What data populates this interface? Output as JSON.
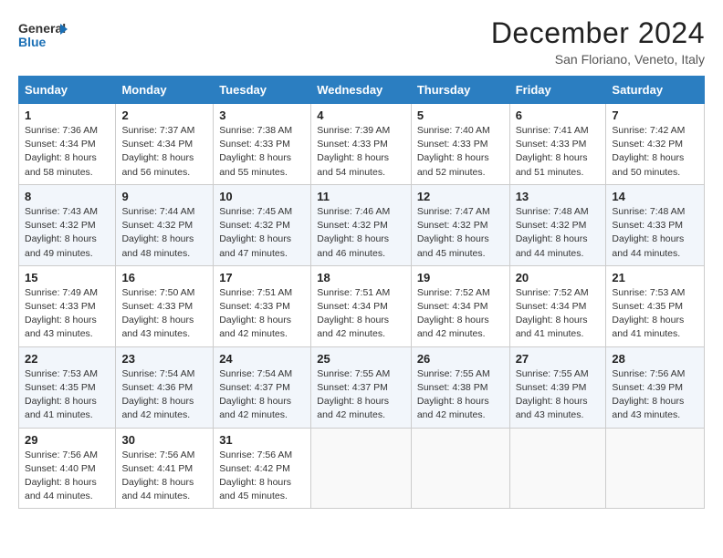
{
  "logo": {
    "line1": "General",
    "line2": "Blue",
    "icon": "▶"
  },
  "title": "December 2024",
  "location": "San Floriano, Veneto, Italy",
  "days_of_week": [
    "Sunday",
    "Monday",
    "Tuesday",
    "Wednesday",
    "Thursday",
    "Friday",
    "Saturday"
  ],
  "weeks": [
    [
      {
        "day": 1,
        "sunrise": "7:36 AM",
        "sunset": "4:34 PM",
        "daylight": "8 hours and 58 minutes."
      },
      {
        "day": 2,
        "sunrise": "7:37 AM",
        "sunset": "4:34 PM",
        "daylight": "8 hours and 56 minutes."
      },
      {
        "day": 3,
        "sunrise": "7:38 AM",
        "sunset": "4:33 PM",
        "daylight": "8 hours and 55 minutes."
      },
      {
        "day": 4,
        "sunrise": "7:39 AM",
        "sunset": "4:33 PM",
        "daylight": "8 hours and 54 minutes."
      },
      {
        "day": 5,
        "sunrise": "7:40 AM",
        "sunset": "4:33 PM",
        "daylight": "8 hours and 52 minutes."
      },
      {
        "day": 6,
        "sunrise": "7:41 AM",
        "sunset": "4:33 PM",
        "daylight": "8 hours and 51 minutes."
      },
      {
        "day": 7,
        "sunrise": "7:42 AM",
        "sunset": "4:32 PM",
        "daylight": "8 hours and 50 minutes."
      }
    ],
    [
      {
        "day": 8,
        "sunrise": "7:43 AM",
        "sunset": "4:32 PM",
        "daylight": "8 hours and 49 minutes."
      },
      {
        "day": 9,
        "sunrise": "7:44 AM",
        "sunset": "4:32 PM",
        "daylight": "8 hours and 48 minutes."
      },
      {
        "day": 10,
        "sunrise": "7:45 AM",
        "sunset": "4:32 PM",
        "daylight": "8 hours and 47 minutes."
      },
      {
        "day": 11,
        "sunrise": "7:46 AM",
        "sunset": "4:32 PM",
        "daylight": "8 hours and 46 minutes."
      },
      {
        "day": 12,
        "sunrise": "7:47 AM",
        "sunset": "4:32 PM",
        "daylight": "8 hours and 45 minutes."
      },
      {
        "day": 13,
        "sunrise": "7:48 AM",
        "sunset": "4:32 PM",
        "daylight": "8 hours and 44 minutes."
      },
      {
        "day": 14,
        "sunrise": "7:48 AM",
        "sunset": "4:33 PM",
        "daylight": "8 hours and 44 minutes."
      }
    ],
    [
      {
        "day": 15,
        "sunrise": "7:49 AM",
        "sunset": "4:33 PM",
        "daylight": "8 hours and 43 minutes."
      },
      {
        "day": 16,
        "sunrise": "7:50 AM",
        "sunset": "4:33 PM",
        "daylight": "8 hours and 43 minutes."
      },
      {
        "day": 17,
        "sunrise": "7:51 AM",
        "sunset": "4:33 PM",
        "daylight": "8 hours and 42 minutes."
      },
      {
        "day": 18,
        "sunrise": "7:51 AM",
        "sunset": "4:34 PM",
        "daylight": "8 hours and 42 minutes."
      },
      {
        "day": 19,
        "sunrise": "7:52 AM",
        "sunset": "4:34 PM",
        "daylight": "8 hours and 42 minutes."
      },
      {
        "day": 20,
        "sunrise": "7:52 AM",
        "sunset": "4:34 PM",
        "daylight": "8 hours and 41 minutes."
      },
      {
        "day": 21,
        "sunrise": "7:53 AM",
        "sunset": "4:35 PM",
        "daylight": "8 hours and 41 minutes."
      }
    ],
    [
      {
        "day": 22,
        "sunrise": "7:53 AM",
        "sunset": "4:35 PM",
        "daylight": "8 hours and 41 minutes."
      },
      {
        "day": 23,
        "sunrise": "7:54 AM",
        "sunset": "4:36 PM",
        "daylight": "8 hours and 42 minutes."
      },
      {
        "day": 24,
        "sunrise": "7:54 AM",
        "sunset": "4:37 PM",
        "daylight": "8 hours and 42 minutes."
      },
      {
        "day": 25,
        "sunrise": "7:55 AM",
        "sunset": "4:37 PM",
        "daylight": "8 hours and 42 minutes."
      },
      {
        "day": 26,
        "sunrise": "7:55 AM",
        "sunset": "4:38 PM",
        "daylight": "8 hours and 42 minutes."
      },
      {
        "day": 27,
        "sunrise": "7:55 AM",
        "sunset": "4:39 PM",
        "daylight": "8 hours and 43 minutes."
      },
      {
        "day": 28,
        "sunrise": "7:56 AM",
        "sunset": "4:39 PM",
        "daylight": "8 hours and 43 minutes."
      }
    ],
    [
      {
        "day": 29,
        "sunrise": "7:56 AM",
        "sunset": "4:40 PM",
        "daylight": "8 hours and 44 minutes."
      },
      {
        "day": 30,
        "sunrise": "7:56 AM",
        "sunset": "4:41 PM",
        "daylight": "8 hours and 44 minutes."
      },
      {
        "day": 31,
        "sunrise": "7:56 AM",
        "sunset": "4:42 PM",
        "daylight": "8 hours and 45 minutes."
      },
      null,
      null,
      null,
      null
    ]
  ]
}
